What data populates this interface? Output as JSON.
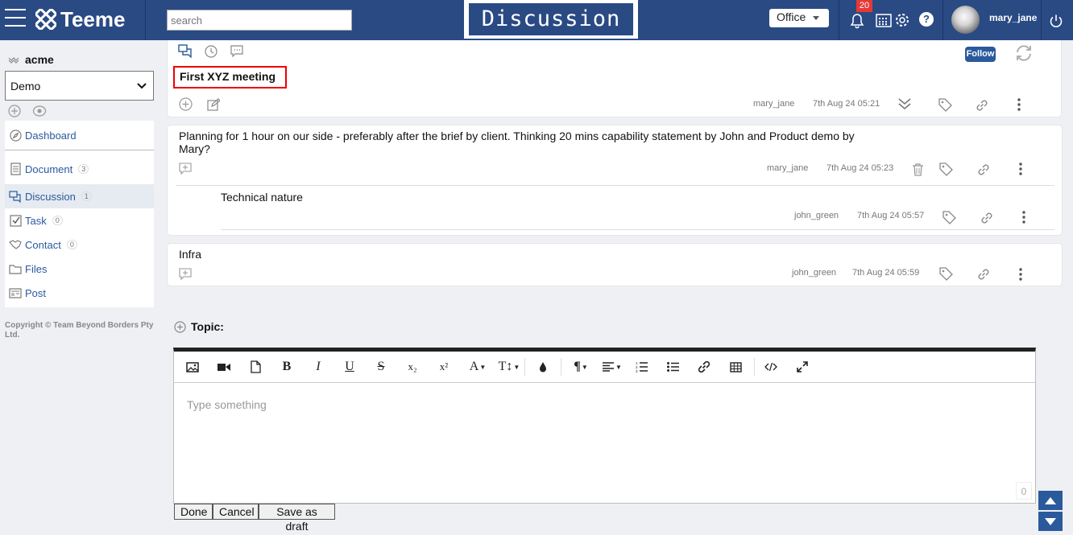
{
  "header": {
    "app_name": "Teeme",
    "search_placeholder": "search",
    "page_title": "Discussion",
    "office_label": "Office",
    "notification_count": "20",
    "help_label": "?",
    "username": "mary_jane"
  },
  "sidebar": {
    "org_name": "acme",
    "workspace_selected": "Demo",
    "items": [
      {
        "label": "Dashboard",
        "count": ""
      },
      {
        "label": "Document",
        "count": "3"
      },
      {
        "label": "Discussion",
        "count": "1"
      },
      {
        "label": "Task",
        "count": "0"
      },
      {
        "label": "Contact",
        "count": "0"
      },
      {
        "label": "Files",
        "count": ""
      },
      {
        "label": "Post",
        "count": ""
      }
    ],
    "copyright": "Copyright © Team Beyond Borders Pty Ltd."
  },
  "discussion": {
    "title": "First XYZ meeting",
    "follow_label": "Follow",
    "author": "mary_jane",
    "time": "7th Aug 24 05:21"
  },
  "comments": [
    {
      "text": "Planning for 1 hour on our side - preferably after the brief by client. Thinking 20 mins capability statement by John and Product demo by Mary?",
      "author": "mary_jane",
      "time": "7th Aug 24 05:23",
      "reply": {
        "text": "Technical nature",
        "author": "john_green",
        "time": "7th Aug 24 05:57"
      }
    },
    {
      "text": "Infra",
      "author": "john_green",
      "time": "7th Aug 24 05:59"
    }
  ],
  "editor": {
    "topic_label": "Topic:",
    "placeholder": "Type something",
    "char_count": "0",
    "toolbar": {
      "bold": "B",
      "italic": "I",
      "underline": "U",
      "strike": "S",
      "subscript": "x₂",
      "superscript": "x²",
      "font_color": "A",
      "font_size": "T↕",
      "paragraph": "¶"
    }
  },
  "actions": {
    "done": "Done",
    "cancel": "Cancel",
    "save_draft": "Save as draft"
  },
  "colors": {
    "header_bg": "#2a4a84",
    "link": "#2a5a9c",
    "highlight_border": "#e00000",
    "badge": "#e53935"
  }
}
